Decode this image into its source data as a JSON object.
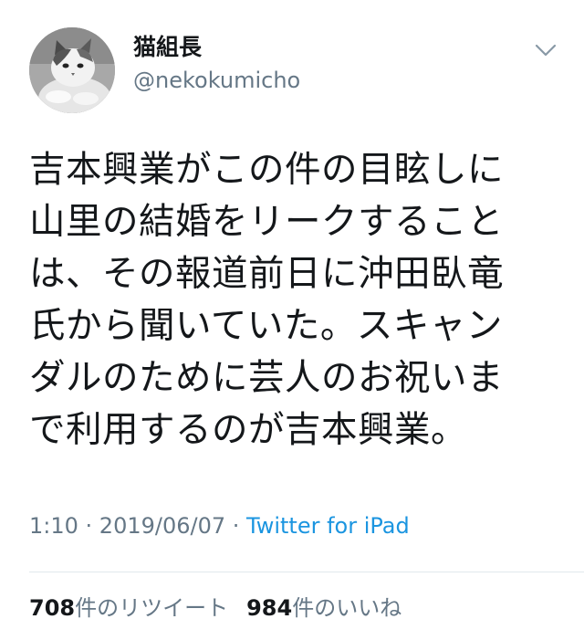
{
  "user": {
    "display_name": "猫組長",
    "username": "@nekokumicho"
  },
  "tweet": {
    "lines": [
      "吉本興業がこの件の目眩しに",
      "山里の結婚をリークすること",
      "は、その報道前日に沖田臥竜",
      "氏から聞いていた。スキャン",
      "ダルのために芸人のお祝いま",
      "で利用するのが吉本興業。"
    ],
    "time": "1:10",
    "separator": " · ",
    "date": "2019/06/07",
    "source": "Twitter for iPad"
  },
  "stats": {
    "retweets": "708",
    "retweets_label": "件のリツイート",
    "likes": "984",
    "likes_label": "件のいいね"
  },
  "icons": {
    "avatar": "cat-photo-avatar",
    "menu": "chevron-down-icon"
  },
  "colors": {
    "text": "#14171a",
    "muted": "#657786",
    "link": "#1b95e0",
    "divider": "#e1e8ed"
  }
}
